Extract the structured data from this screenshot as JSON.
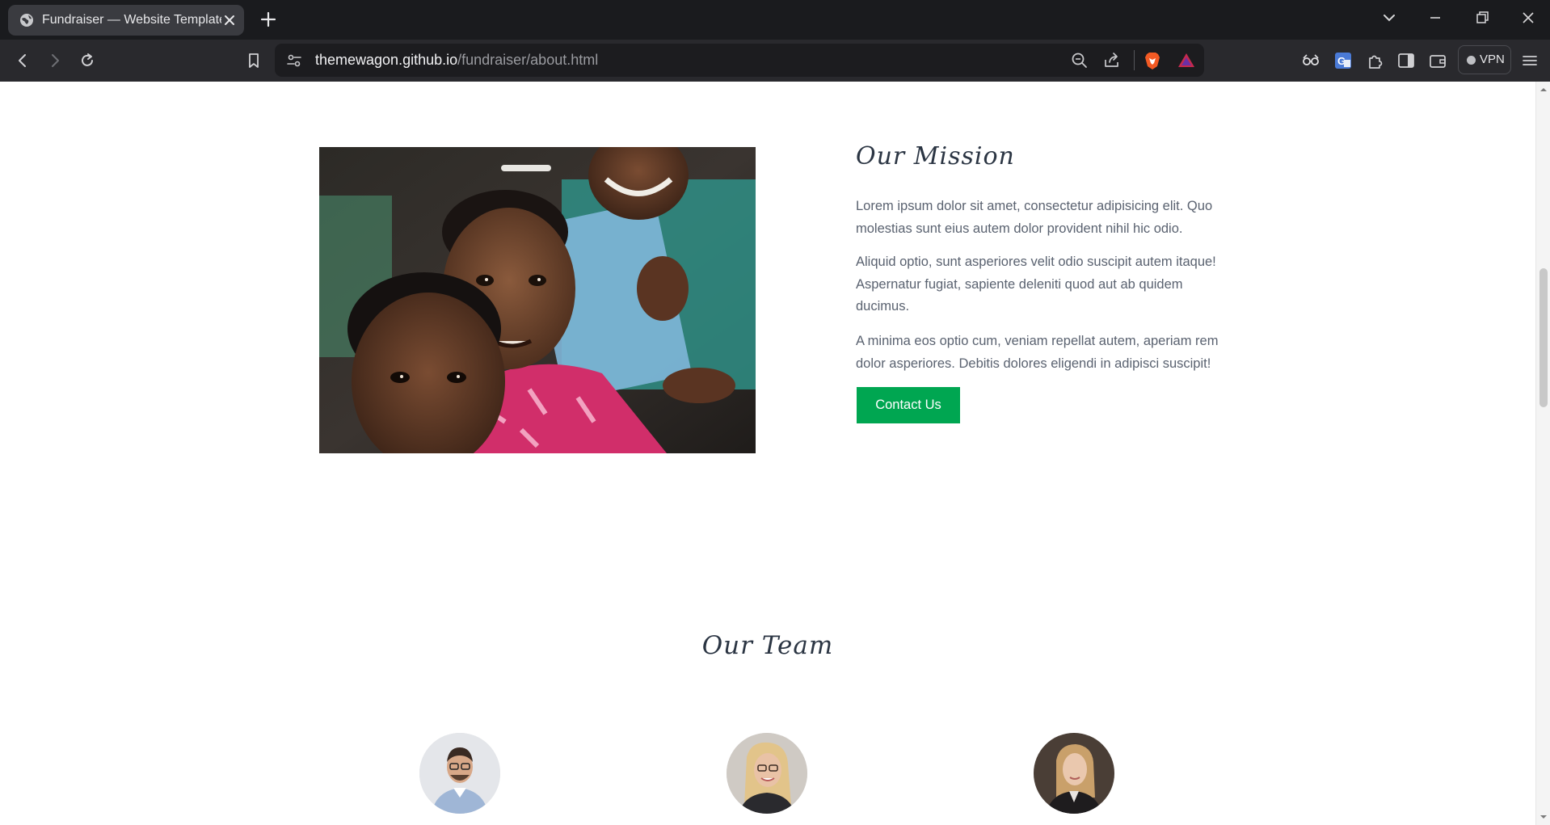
{
  "browser": {
    "tab_title": "Fundraiser — Website Template",
    "url_domain": "themewagon.github.io",
    "url_path": "/fundraiser/about.html",
    "vpn_label": "VPN"
  },
  "mission": {
    "heading": "Our Mission",
    "paragraphs": [
      "Lorem ipsum dolor sit amet, consectetur adipisicing elit. Quo molestias sunt eius autem dolor provident nihil hic odio.",
      "Aliquid optio, sunt asperiores velit odio suscipit autem itaque! Aspernatur fugiat, sapiente deleniti quod aut ab quidem ducimus.",
      "A minima eos optio cum, veniam repellat autem, aperiam rem dolor asperiores. Debitis dolores eligendi in adipisci suscipit!"
    ],
    "button_label": "Contact Us"
  },
  "team": {
    "heading": "Our Team"
  },
  "colors": {
    "accent": "#00a651",
    "heading": "#2b3543",
    "body_text": "#5a6270"
  }
}
